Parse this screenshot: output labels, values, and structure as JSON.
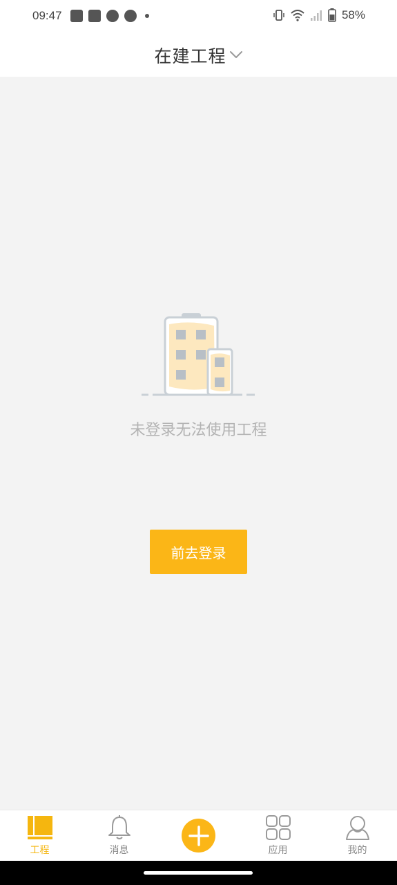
{
  "status_bar": {
    "time": "09:47",
    "battery": "58%",
    "icons": [
      "shopping-bag-icon",
      "shopping-bag-icon",
      "compass-icon",
      "compass-icon",
      "dot-icon",
      "vibrate-icon",
      "wifi-icon",
      "signal-icon",
      "battery-icon"
    ]
  },
  "header": {
    "title": "在建工程",
    "dropdown_icon": "chevron-down-icon"
  },
  "empty_state": {
    "icon": "building-icon",
    "message": "未登录无法使用工程",
    "button_label": "前去登录"
  },
  "tab_bar": {
    "tabs": [
      {
        "label": "工程",
        "icon": "project-icon",
        "active": true
      },
      {
        "label": "消息",
        "icon": "bell-icon",
        "active": false
      },
      {
        "label": "",
        "icon": "plus-icon",
        "active": false
      },
      {
        "label": "应用",
        "icon": "apps-grid-icon",
        "active": false
      },
      {
        "label": "我的",
        "icon": "user-icon",
        "active": false
      }
    ]
  },
  "colors": {
    "accent": "#fbb617",
    "background": "#f3f3f3",
    "muted_text": "#b3b3b3"
  }
}
